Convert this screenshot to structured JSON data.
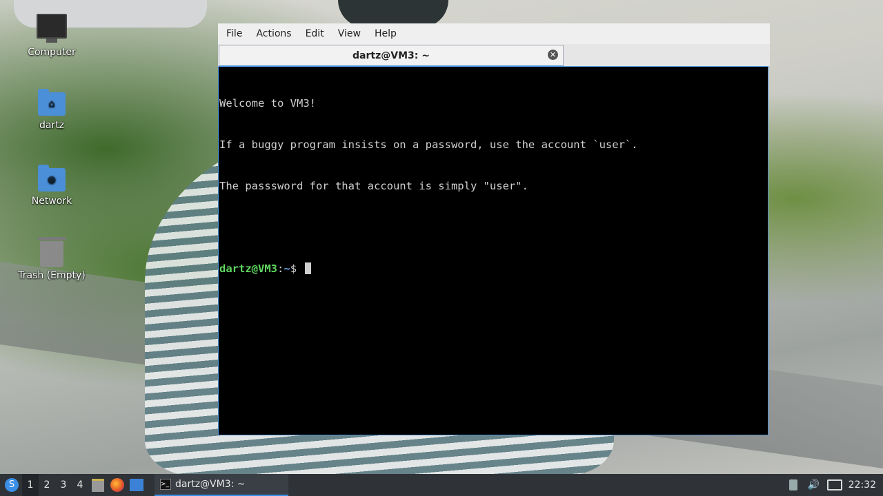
{
  "desktop": {
    "icons": [
      {
        "label": "Computer"
      },
      {
        "label": "dartz"
      },
      {
        "label": "Network"
      },
      {
        "label": "Trash (Empty)"
      }
    ]
  },
  "terminal": {
    "menu": [
      "File",
      "Actions",
      "Edit",
      "View",
      "Help"
    ],
    "tab_title": "dartz@VM3: ~",
    "lines": [
      "Welcome to VM3!",
      "If a buggy program insists on a password, use the account `user`.",
      "The passsword for that account is simply \"user\".",
      ""
    ],
    "prompt": {
      "user_host": "dartz@VM3",
      "sep": ":",
      "path": "~",
      "symbol": "$ "
    }
  },
  "taskbar": {
    "workspaces": [
      "1",
      "2",
      "3",
      "4"
    ],
    "active_workspace": "1",
    "task_label": "dartz@VM3: ~",
    "clock": "22:32",
    "accent": "#3a8ee6"
  }
}
